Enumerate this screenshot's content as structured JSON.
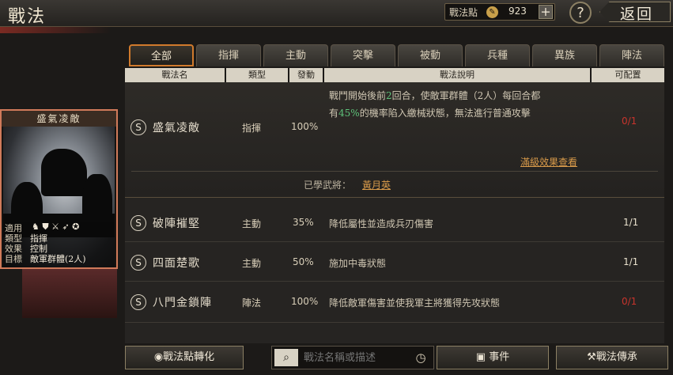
{
  "header": {
    "title": "戰法",
    "points_label": "戰法點",
    "points_value": "923",
    "add_label": "+",
    "help_label": "?",
    "back_label": "返回"
  },
  "tabs": [
    {
      "label": "全部",
      "active": true
    },
    {
      "label": "指揮",
      "active": false
    },
    {
      "label": "主動",
      "active": false
    },
    {
      "label": "突擊",
      "active": false
    },
    {
      "label": "被動",
      "active": false
    },
    {
      "label": "兵種",
      "active": false
    },
    {
      "label": "異族",
      "active": false
    },
    {
      "label": "陣法",
      "active": false
    }
  ],
  "columns": [
    "戰法名",
    "類型",
    "發動",
    "戰法說明",
    "可配置"
  ],
  "card": {
    "title": "盛氣凌敵",
    "stats": [
      {
        "key": "適用",
        "value": ""
      },
      {
        "key": "類型",
        "value": "指揮"
      },
      {
        "key": "效果",
        "value": "控制"
      },
      {
        "key": "目標",
        "value": "敵軍群體(2人)"
      }
    ]
  },
  "rows": [
    {
      "grade": "S",
      "name": "盛氣凌敵",
      "type": "指揮",
      "rate": "100%",
      "desc_line1_a": "戰鬥開始後前",
      "desc_line1_b": "2",
      "desc_line1_c": "回合，使敵軍群體（2人）每回合都",
      "desc_line2_a": "有",
      "desc_line2_b": "45%",
      "desc_line2_c": "的機率陷入繳械狀態，無法進行普通攻擊",
      "config": "0/1",
      "full_effect_link": "滿級效果查看",
      "learned_label": "已學武將：",
      "learned_general": "黃月英"
    },
    {
      "grade": "S",
      "name": "破陣摧堅",
      "type": "主動",
      "rate": "35%",
      "desc": "降低屬性並造成兵刃傷害",
      "config": "1/1"
    },
    {
      "grade": "S",
      "name": "四面楚歌",
      "type": "主動",
      "rate": "50%",
      "desc": "施加中毒狀態",
      "config": "1/1"
    },
    {
      "grade": "S",
      "name": "八門金鎖陣",
      "type": "陣法",
      "rate": "100%",
      "desc": "降低敵軍傷害並使我軍主將獲得先攻狀態",
      "config": "0/1"
    }
  ],
  "bottom": {
    "convert_label": "戰法點轉化",
    "search_placeholder": "戰法名稱或描述",
    "event_label": "事件",
    "inherit_label": "戰法傳承"
  },
  "colors": {
    "accent": "#d07a2c",
    "highlight_green": "#5ec27a",
    "config_red": "#c8342c",
    "link_orange": "#d89a4a"
  }
}
